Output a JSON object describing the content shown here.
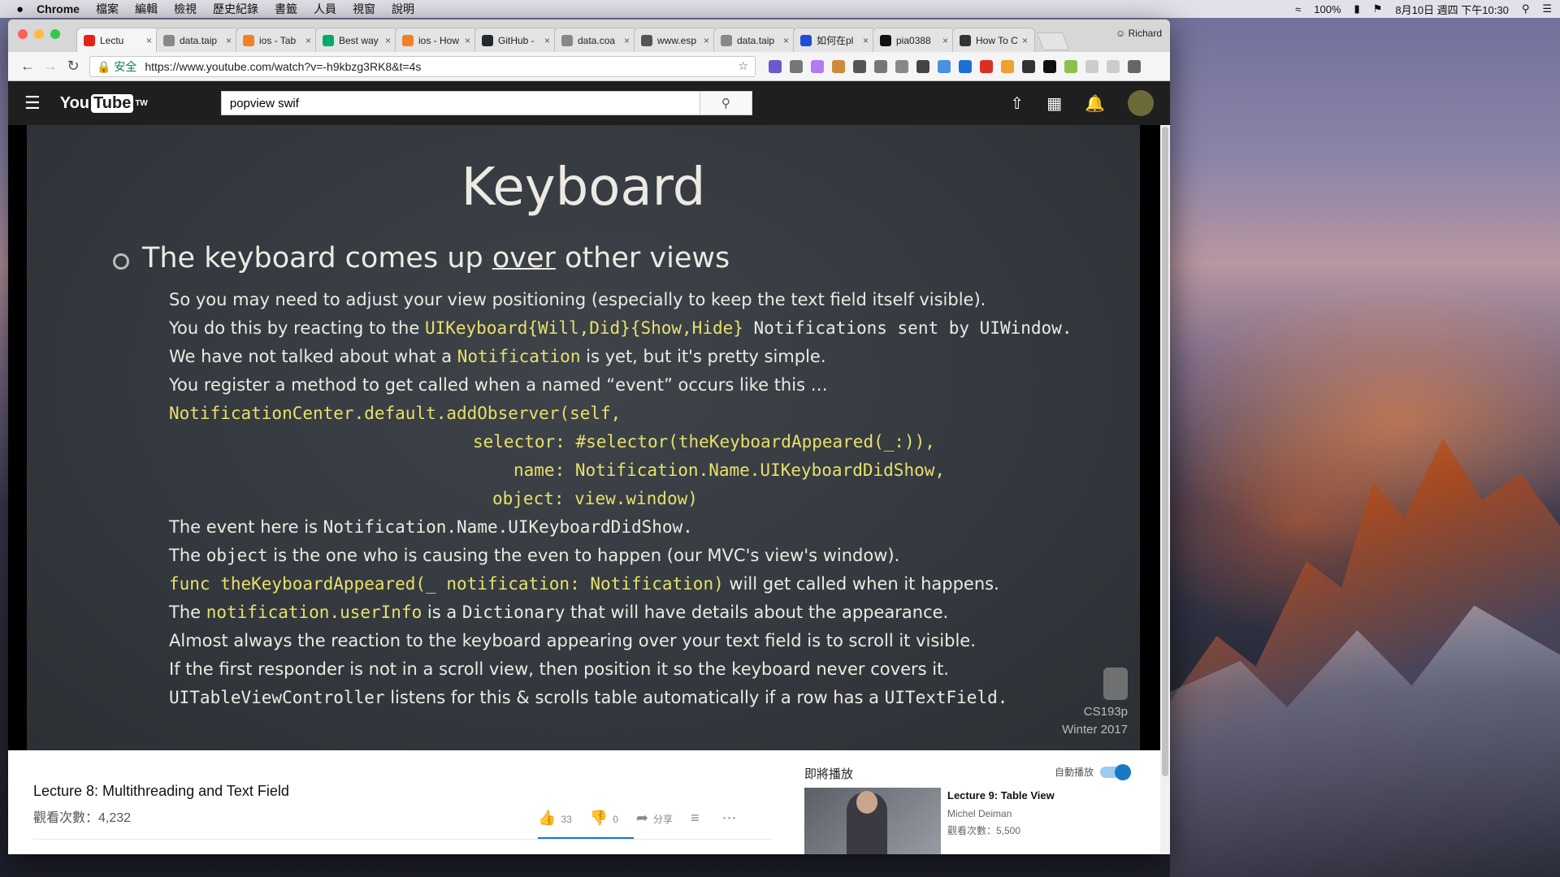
{
  "menubar": {
    "apple": "",
    "app_name": "Chrome",
    "items": [
      "檔案",
      "編輯",
      "檢視",
      "歷史紀錄",
      "書籤",
      "人員",
      "視窗",
      "說明"
    ],
    "battery": "100%",
    "datetime": "8月10日 週四 下午10:30"
  },
  "browser": {
    "tabs": [
      {
        "label": "Lectu",
        "color": "#e62117"
      },
      {
        "label": "data.taip",
        "color": "#888888"
      },
      {
        "label": "ios - Tab",
        "color": "#f48024"
      },
      {
        "label": "Best way",
        "color": "#00ab6c"
      },
      {
        "label": "ios - How",
        "color": "#f48024"
      },
      {
        "label": "GitHub -",
        "color": "#24292e"
      },
      {
        "label": "data.coa",
        "color": "#888888"
      },
      {
        "label": "www.esp",
        "color": "#555555"
      },
      {
        "label": "data.taip",
        "color": "#888888"
      },
      {
        "label": "如何在pl",
        "color": "#1d4ed8"
      },
      {
        "label": "pia0388",
        "color": "#111111"
      },
      {
        "label": "How To C",
        "color": "#333333"
      }
    ],
    "tab_close": "×",
    "profile": "Richard",
    "secure_label": "安全",
    "url": "https://www.youtube.com/watch?v=-h9kbzg3RK8&t=4s"
  },
  "youtube": {
    "logo_you": "You",
    "logo_tube": "Tube",
    "logo_region": "TW",
    "search_value": "popview swif",
    "video_title": "Lecture 8: Multithreading and Text Field",
    "views": "觀看次數：4,232",
    "likes": "33",
    "dislikes": "0",
    "share": "分享",
    "upnext_label": "即將播放",
    "autoplay_label": "自動播放",
    "next_title": "Lecture 9: Table View",
    "next_author": "Michel Deiman",
    "next_views": "觀看次數：5,500"
  },
  "slide": {
    "title": "Keyboard",
    "heading_pre": "The keyboard comes up ",
    "heading_u": "over",
    "heading_post": " other views",
    "l1": "So you may need to adjust your view positioning (especially to keep the text field itself visible).",
    "l2a": "You do this by reacting to the ",
    "l2b": "UIKeyboard{Will,Did}{Show,Hide}",
    "l2c": " Notifications sent by UIWindow.",
    "l3a": "We have not talked about what a ",
    "l3b": "Notification",
    "l3c": " is yet, but it's pretty simple.",
    "l4": "You register a method to get called when a named “event” occurs like this …",
    "c1": "NotificationCenter.default.addObserver(self,",
    "c2a": "selector: ",
    "c2b": "#selector(theKeyboardAppeared(_:)),",
    "c3a": "name: ",
    "c3b": "Notification.Name.UIKeyboardDidShow,",
    "c4a": "object: ",
    "c4b": "view.window)",
    "l5a": "The event here is ",
    "l5b": "Notification.Name.UIKeyboardDidShow.",
    "l6a": "The ",
    "l6b": "object",
    "l6c": " is the one who is causing the even to happen (our MVC's view's window).",
    "l7a": "func theKeyboardAppeared(_ notification: Notification)",
    "l7b": " will get called when it happens.",
    "l8a": "The ",
    "l8b": "notification.userInfo",
    "l8c": " is a ",
    "l8d": "Dictionary",
    "l8e": " that will have details about the appearance.",
    "l9": "Almost always the reaction to the keyboard appearing over your text field is to scroll it visible.",
    "l10": "If the first responder is not in a scroll view, then position it so the keyboard never covers it.",
    "l11a": "UITableViewController",
    "l11b": " listens for this & scrolls table automatically if a row has a ",
    "l11c": "UITextField.",
    "wm1": "CS193p",
    "wm2": "Winter 2017"
  }
}
